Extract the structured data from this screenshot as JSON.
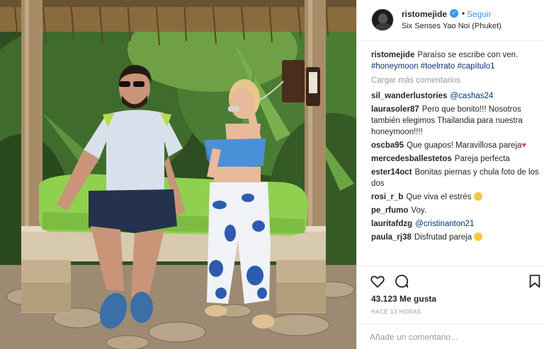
{
  "post": {
    "username": "ristomejide",
    "verified_icon": "verified-badge-icon",
    "separator": "•",
    "follow_label": "Seguir",
    "location": "Six Senses Yao Noi (Phuket)"
  },
  "caption": {
    "username": "ristomejide",
    "text": "Paraíso se escribe con ven.",
    "hashtags": "#honeymoon #toelrrato #capítulo1"
  },
  "load_more_label": "Cargar más comentarios",
  "comments": [
    {
      "user": "sil_wanderlustories",
      "text": "",
      "mention": "@cashas24"
    },
    {
      "user": "laurasoler87",
      "text": "Pero que bonito!!! Nosotros también elegimos Thailandia para nuestra honeymoon!!!!",
      "mention": ""
    },
    {
      "user": "oscba95",
      "text": "Que guapos! Maravillosa pareja",
      "mention": ""
    },
    {
      "user": "mercedesballestetos",
      "text": "Pareja perfecta",
      "mention": ""
    },
    {
      "user": "ester14oct",
      "text": "Bonitas piernas y chula foto de los dos",
      "mention": ""
    },
    {
      "user": "rosi_r_b",
      "text": "Que viva el estrés",
      "mention": ""
    },
    {
      "user": "pe_rfumo",
      "text": "Voy.",
      "mention": ""
    },
    {
      "user": "lauritafdzg",
      "text": "",
      "mention": "@cristinanton21"
    },
    {
      "user": "paula_rj38",
      "text": "Disfrutad pareja",
      "mention": ""
    }
  ],
  "likes_count": "43.123",
  "likes_label": "Me gusta",
  "timestamp": "HACE 13 HORAS",
  "comment_placeholder": "Añade un comentario...",
  "icons": {
    "like": "heart-outline-icon",
    "comment": "comment-bubble-icon",
    "save": "bookmark-icon"
  },
  "colors": {
    "link": "#003569",
    "follow": "#3897f0",
    "muted": "#999999",
    "cushion": "#8fd14f",
    "top": "#4a90d9"
  }
}
